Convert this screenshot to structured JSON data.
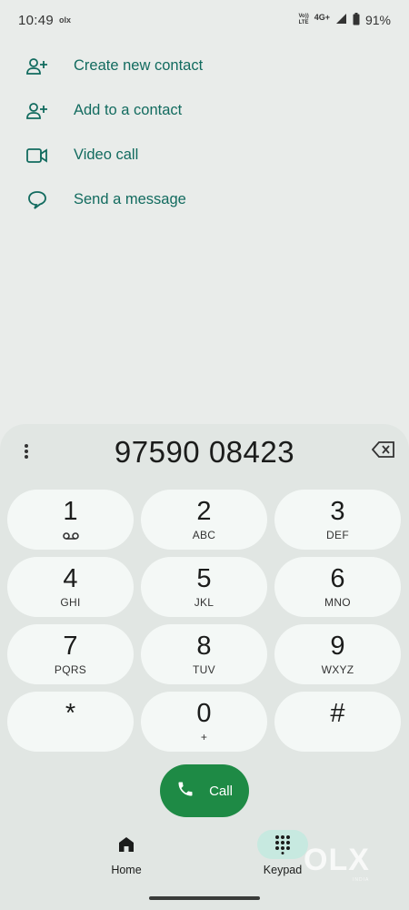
{
  "status_bar": {
    "time": "10:49",
    "notification_icon_text": "olx",
    "volte_top": "Vo))",
    "volte_bottom": "LTE",
    "network": "4G+",
    "battery": "91%"
  },
  "actions": [
    {
      "label": "Create new contact",
      "icon": "add-person-icon"
    },
    {
      "label": "Add to a contact",
      "icon": "add-person-icon"
    },
    {
      "label": "Video call",
      "icon": "video-camera-icon"
    },
    {
      "label": "Send a message",
      "icon": "message-bubble-icon"
    }
  ],
  "dialer": {
    "number": "97590 08423",
    "keys": [
      {
        "digit": "1",
        "letters": "",
        "sub_icon": "voicemail-icon"
      },
      {
        "digit": "2",
        "letters": "ABC"
      },
      {
        "digit": "3",
        "letters": "DEF"
      },
      {
        "digit": "4",
        "letters": "GHI"
      },
      {
        "digit": "5",
        "letters": "JKL"
      },
      {
        "digit": "6",
        "letters": "MNO"
      },
      {
        "digit": "7",
        "letters": "PQRS"
      },
      {
        "digit": "8",
        "letters": "TUV"
      },
      {
        "digit": "9",
        "letters": "WXYZ"
      },
      {
        "digit": "*",
        "letters": ""
      },
      {
        "digit": "0",
        "letters": "+"
      },
      {
        "digit": "#",
        "letters": ""
      }
    ],
    "call_label": "Call"
  },
  "nav": {
    "home_label": "Home",
    "keypad_label": "Keypad",
    "selected": "keypad"
  },
  "watermark": {
    "logo_text": "OLX",
    "sub_text": "INDIA"
  },
  "colors": {
    "accent_teal": "#126b5f",
    "call_green": "#1e8a45",
    "background": "#e9ecea",
    "key_fill": "#f4f8f6",
    "nav_selected": "#c7e9e0"
  }
}
